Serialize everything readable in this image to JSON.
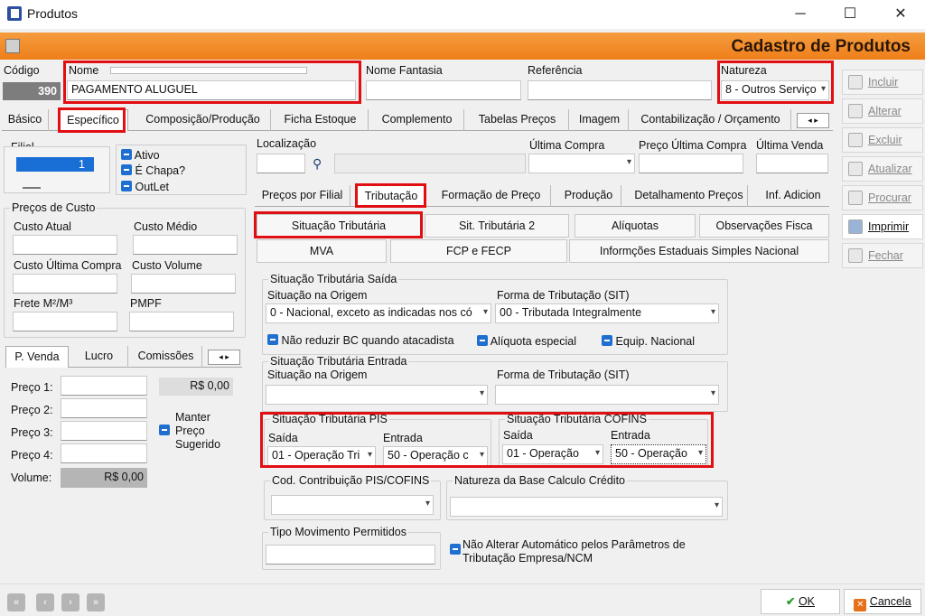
{
  "window": {
    "title": "Produtos",
    "minimize": "─",
    "maximize": "☐",
    "close": "✕"
  },
  "banner": {
    "title": "Cadastro de Produtos"
  },
  "header": {
    "codigo_label": "Código",
    "codigo_value": "390",
    "nome_label": "Nome",
    "nome_value": "PAGAMENTO ALUGUEL",
    "nome_fantasia_label": "Nome Fantasia",
    "referencia_label": "Referência",
    "natureza_label": "Natureza",
    "natureza_value": "8 - Outros Serviço"
  },
  "main_tabs": [
    "Básico",
    "Específico",
    "Composição/Produção",
    "Ficha Estoque",
    "Complemento",
    "Tabelas Preços",
    "Imagem",
    "Contabilização / Orçamento"
  ],
  "left": {
    "filial_label": "Filial",
    "filial_value": "1",
    "ativo": "Ativo",
    "chapa": "É Chapa?",
    "outlet": "OutLet",
    "precos_custo": "Preços de Custo",
    "custo_atual": "Custo Atual",
    "custo_medio": "Custo Médio",
    "custo_ultima": "Custo Última Compra",
    "custo_volume": "Custo Volume",
    "frete": "Frete M²/M³",
    "pmpf": "PMPF",
    "venda_tabs": [
      "P. Venda",
      "Lucro",
      "Comissões"
    ],
    "preco1": "Preço 1:",
    "preco2": "Preço 2:",
    "preco3": "Preço 3:",
    "preco4": "Preço 4:",
    "preco1_total": "R$ 0,00",
    "manter": "Manter Preço Sugerido",
    "volume_label": "Volume:",
    "volume_value": "R$ 0,00"
  },
  "right": {
    "localizacao": "Localização",
    "ultima_compra": "Última Compra",
    "preco_ultima_compra": "Preço Última Compra",
    "ultima_venda": "Última Venda",
    "sub_tabs": [
      "Preços por Filial",
      "Tributação",
      "Formação de Preço",
      "Produção",
      "Detalhamento Preços",
      "Inf. Adicion"
    ],
    "trib_buttons": [
      "Situação Tributária",
      "Sit. Tributária 2",
      "Alíquotas",
      "Observações Fisca",
      "MVA",
      "FCP e FECP",
      "Informções Estaduais Simples Nacional"
    ],
    "saida_group": "Situação Tributária Saída",
    "situacao_origem": "Situação na Origem",
    "forma_tributacao": "Forma de Tributação (SIT)",
    "origem_value": "0 - Nacional, exceto as indicadas nos có",
    "forma_value": "00 - Tributada Integralmente",
    "nao_reduzir": "Não reduzir BC quando atacadista",
    "aliquota_especial": "Alíquota especial",
    "equip_nacional": "Equip. Nacional",
    "entrada_group": "Situação Tributária Entrada",
    "pis_group": "Situação Tributária PIS",
    "cofins_group": "Situação Tributária COFINS",
    "saida": "Saída",
    "entrada": "Entrada",
    "pis_saida": "01 - Operação Tri",
    "pis_entrada": "50 - Operação c",
    "cofins_saida": "01 - Operação",
    "cofins_entrada": "50 - Operação",
    "cod_contribuicao": "Cod. Contribuição PIS/COFINS",
    "natureza_base": "Natureza da Base Calculo Crédito",
    "tipo_movimento": "Tipo Movimento Permitidos",
    "nao_alterar": "Não Alterar Automático pelos Parâmetros de Tributação Empresa/NCM"
  },
  "side": [
    "Incluir",
    "Alterar",
    "Excluir",
    "Atualizar",
    "Procurar",
    "Imprimir",
    "Fechar"
  ],
  "footer": {
    "ok": "OK",
    "cancela": "Cancela"
  }
}
